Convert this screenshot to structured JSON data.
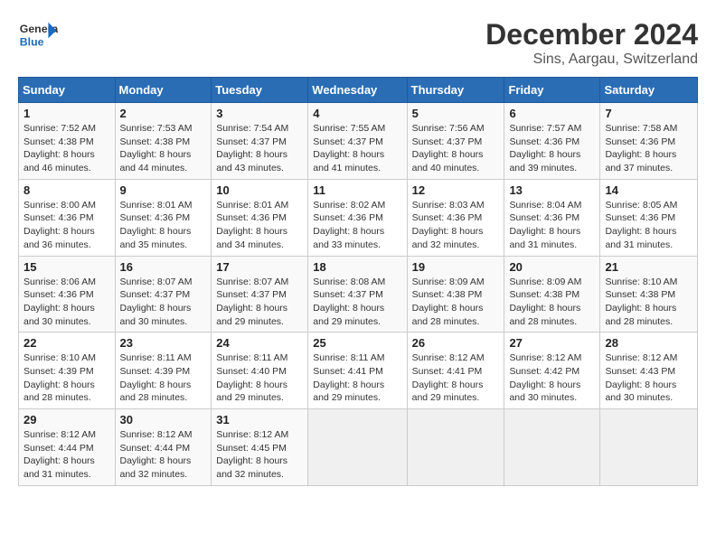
{
  "header": {
    "logo_general": "General",
    "logo_blue": "Blue",
    "title": "December 2024",
    "subtitle": "Sins, Aargau, Switzerland"
  },
  "days_of_week": [
    "Sunday",
    "Monday",
    "Tuesday",
    "Wednesday",
    "Thursday",
    "Friday",
    "Saturday"
  ],
  "weeks": [
    [
      {
        "day": "1",
        "sunrise": "7:52 AM",
        "sunset": "4:38 PM",
        "daylight": "8 hours and 46 minutes."
      },
      {
        "day": "2",
        "sunrise": "7:53 AM",
        "sunset": "4:38 PM",
        "daylight": "8 hours and 44 minutes."
      },
      {
        "day": "3",
        "sunrise": "7:54 AM",
        "sunset": "4:37 PM",
        "daylight": "8 hours and 43 minutes."
      },
      {
        "day": "4",
        "sunrise": "7:55 AM",
        "sunset": "4:37 PM",
        "daylight": "8 hours and 41 minutes."
      },
      {
        "day": "5",
        "sunrise": "7:56 AM",
        "sunset": "4:37 PM",
        "daylight": "8 hours and 40 minutes."
      },
      {
        "day": "6",
        "sunrise": "7:57 AM",
        "sunset": "4:36 PM",
        "daylight": "8 hours and 39 minutes."
      },
      {
        "day": "7",
        "sunrise": "7:58 AM",
        "sunset": "4:36 PM",
        "daylight": "8 hours and 37 minutes."
      }
    ],
    [
      {
        "day": "8",
        "sunrise": "8:00 AM",
        "sunset": "4:36 PM",
        "daylight": "8 hours and 36 minutes."
      },
      {
        "day": "9",
        "sunrise": "8:01 AM",
        "sunset": "4:36 PM",
        "daylight": "8 hours and 35 minutes."
      },
      {
        "day": "10",
        "sunrise": "8:01 AM",
        "sunset": "4:36 PM",
        "daylight": "8 hours and 34 minutes."
      },
      {
        "day": "11",
        "sunrise": "8:02 AM",
        "sunset": "4:36 PM",
        "daylight": "8 hours and 33 minutes."
      },
      {
        "day": "12",
        "sunrise": "8:03 AM",
        "sunset": "4:36 PM",
        "daylight": "8 hours and 32 minutes."
      },
      {
        "day": "13",
        "sunrise": "8:04 AM",
        "sunset": "4:36 PM",
        "daylight": "8 hours and 31 minutes."
      },
      {
        "day": "14",
        "sunrise": "8:05 AM",
        "sunset": "4:36 PM",
        "daylight": "8 hours and 31 minutes."
      }
    ],
    [
      {
        "day": "15",
        "sunrise": "8:06 AM",
        "sunset": "4:36 PM",
        "daylight": "8 hours and 30 minutes."
      },
      {
        "day": "16",
        "sunrise": "8:07 AM",
        "sunset": "4:37 PM",
        "daylight": "8 hours and 30 minutes."
      },
      {
        "day": "17",
        "sunrise": "8:07 AM",
        "sunset": "4:37 PM",
        "daylight": "8 hours and 29 minutes."
      },
      {
        "day": "18",
        "sunrise": "8:08 AM",
        "sunset": "4:37 PM",
        "daylight": "8 hours and 29 minutes."
      },
      {
        "day": "19",
        "sunrise": "8:09 AM",
        "sunset": "4:38 PM",
        "daylight": "8 hours and 28 minutes."
      },
      {
        "day": "20",
        "sunrise": "8:09 AM",
        "sunset": "4:38 PM",
        "daylight": "8 hours and 28 minutes."
      },
      {
        "day": "21",
        "sunrise": "8:10 AM",
        "sunset": "4:38 PM",
        "daylight": "8 hours and 28 minutes."
      }
    ],
    [
      {
        "day": "22",
        "sunrise": "8:10 AM",
        "sunset": "4:39 PM",
        "daylight": "8 hours and 28 minutes."
      },
      {
        "day": "23",
        "sunrise": "8:11 AM",
        "sunset": "4:39 PM",
        "daylight": "8 hours and 28 minutes."
      },
      {
        "day": "24",
        "sunrise": "8:11 AM",
        "sunset": "4:40 PM",
        "daylight": "8 hours and 29 minutes."
      },
      {
        "day": "25",
        "sunrise": "8:11 AM",
        "sunset": "4:41 PM",
        "daylight": "8 hours and 29 minutes."
      },
      {
        "day": "26",
        "sunrise": "8:12 AM",
        "sunset": "4:41 PM",
        "daylight": "8 hours and 29 minutes."
      },
      {
        "day": "27",
        "sunrise": "8:12 AM",
        "sunset": "4:42 PM",
        "daylight": "8 hours and 30 minutes."
      },
      {
        "day": "28",
        "sunrise": "8:12 AM",
        "sunset": "4:43 PM",
        "daylight": "8 hours and 30 minutes."
      }
    ],
    [
      {
        "day": "29",
        "sunrise": "8:12 AM",
        "sunset": "4:44 PM",
        "daylight": "8 hours and 31 minutes."
      },
      {
        "day": "30",
        "sunrise": "8:12 AM",
        "sunset": "4:44 PM",
        "daylight": "8 hours and 32 minutes."
      },
      {
        "day": "31",
        "sunrise": "8:12 AM",
        "sunset": "4:45 PM",
        "daylight": "8 hours and 32 minutes."
      },
      null,
      null,
      null,
      null
    ]
  ],
  "labels": {
    "sunrise": "Sunrise:",
    "sunset": "Sunset:",
    "daylight": "Daylight:"
  }
}
